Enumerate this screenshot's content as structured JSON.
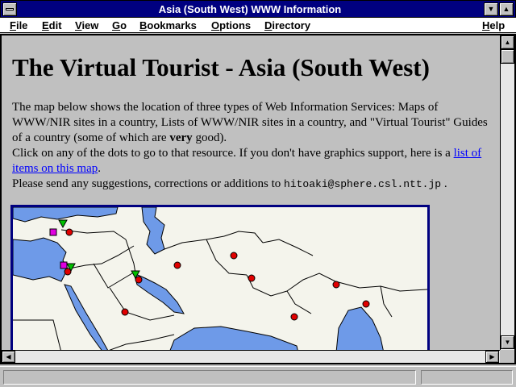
{
  "window": {
    "title": "Asia (South West) WWW Information"
  },
  "menubar": {
    "items": [
      {
        "accel": "F",
        "rest": "ile"
      },
      {
        "accel": "E",
        "rest": "dit"
      },
      {
        "accel": "V",
        "rest": "iew"
      },
      {
        "accel": "G",
        "rest": "o"
      },
      {
        "accel": "B",
        "rest": "ookmarks"
      },
      {
        "accel": "O",
        "rest": "ptions"
      },
      {
        "accel": "D",
        "rest": "irectory"
      },
      {
        "accel": "H",
        "rest": "elp"
      }
    ]
  },
  "page": {
    "heading": "The Virtual Tourist - Asia (South West)",
    "intro_1": "The map below shows the location of three types of Web Information Services: Maps of WWW/NIR sites in a country, Lists of WWW/NIR sites in a country, and \"Virtual Tourist\" Guides of a country (some of which are ",
    "intro_bold": "very",
    "intro_2": " good).",
    "click_text": "Click on any of the dots to go to that resource. If you don't have graphics support, here is a ",
    "list_link": "list of items on this map",
    "click_end": ".",
    "send_text": "Please send any suggestions, corrections or additions to ",
    "email": "hitoaki@sphere.csl.ntt.jp",
    "send_end": " ."
  },
  "map": {
    "land_color": "#f4f4ec",
    "sea_color": "#6e9ae8",
    "border_color": "#000080",
    "dot_color": "#e00000",
    "triangle_color": "#00c000",
    "square_color": "#e000e0"
  },
  "statusbar": {
    "text": ""
  }
}
